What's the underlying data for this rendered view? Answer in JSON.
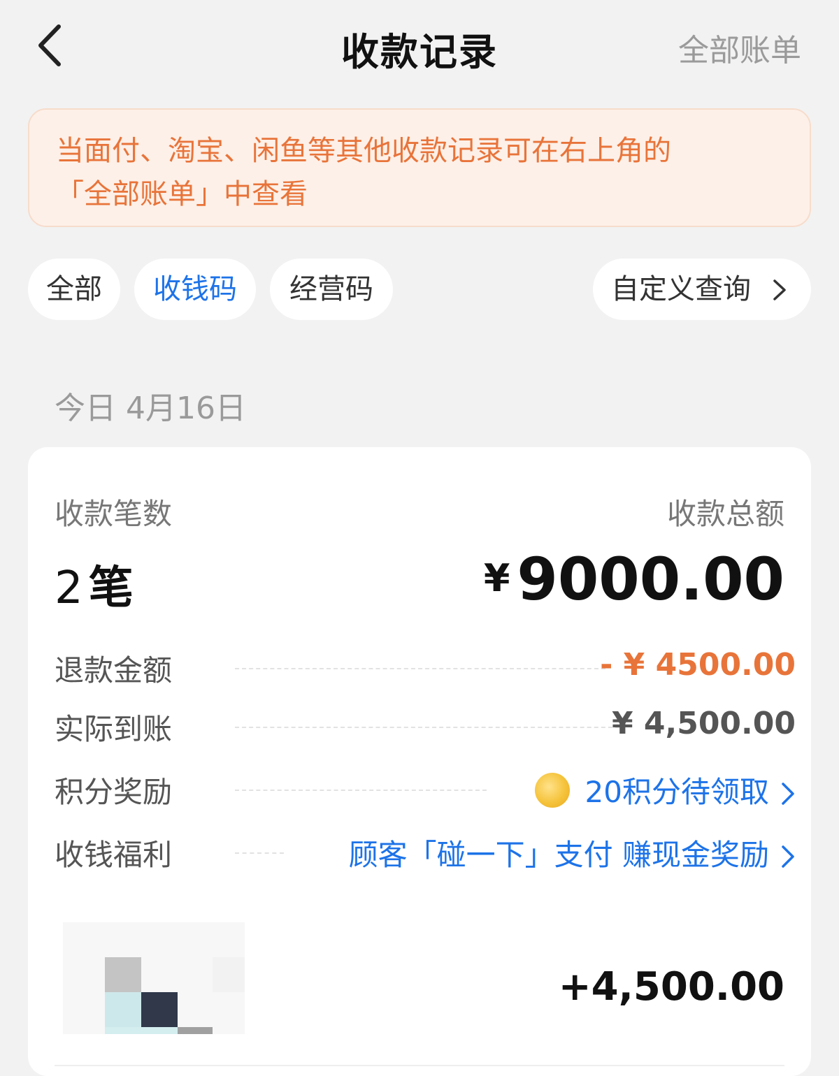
{
  "header": {
    "title": "收款记录",
    "right_link": "全部账单"
  },
  "notice": {
    "line1": "当面付、淘宝、闲鱼等其他收款记录可在右上角的",
    "line2": "「全部账单」中查看"
  },
  "filters": {
    "all": "全部",
    "collect_code": "收钱码",
    "business_code": "经营码",
    "active": "收钱码",
    "custom_query": "自定义查询"
  },
  "date_label": "今日 4月16日",
  "summary": {
    "count_label": "收款笔数",
    "count_value": "2",
    "count_unit": "笔",
    "total_label": "收款总额",
    "total_symbol": "¥",
    "total_value": "9000.00"
  },
  "details": [
    {
      "label": "退款金额",
      "value": "- ¥ 4500.00"
    },
    {
      "label": "实际到账",
      "value": "¥ 4,500.00"
    },
    {
      "label": "积分奖励",
      "value": "20积分待领取"
    },
    {
      "label": "收钱福利",
      "value": "顾客「碰一下」支付 赚现金奖励"
    }
  ],
  "transaction": {
    "amount": "+4,500.00"
  },
  "colors": {
    "accent_blue": "#1d73e8",
    "refund_orange": "#e8743a",
    "notice_bg": "#fdf0e8"
  },
  "icons": [
    "back-arrow-icon",
    "chevron-right-icon",
    "coin-icon"
  ]
}
